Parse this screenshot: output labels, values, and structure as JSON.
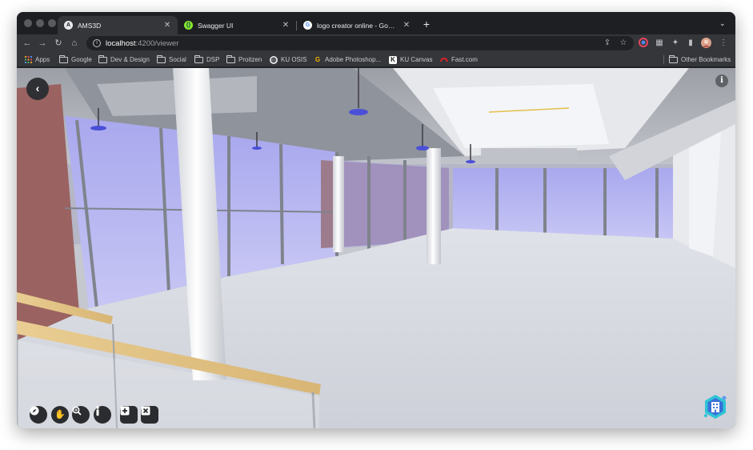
{
  "tabs": [
    {
      "title": "AMS3D",
      "favicon": "A",
      "active": true
    },
    {
      "title": "Swagger UI",
      "favicon": "swagger-icon",
      "active": false
    },
    {
      "title": "logo creator online - Google Se",
      "favicon": "google-icon",
      "active": false
    }
  ],
  "new_tab_label": "+",
  "address": {
    "host": "localhost",
    "path": ":4200/viewer"
  },
  "bookmarks": [
    {
      "label": "Apps",
      "icon": "apps-grid-icon"
    },
    {
      "label": "Google",
      "icon": "folder-icon"
    },
    {
      "label": "Dev & Design",
      "icon": "folder-icon"
    },
    {
      "label": "Social",
      "icon": "folder-icon"
    },
    {
      "label": "DSP",
      "icon": "folder-icon"
    },
    {
      "label": "Proitzen",
      "icon": "folder-icon"
    },
    {
      "label": "KU OSIS",
      "icon": "globe-icon"
    },
    {
      "label": "Adobe Photoshop...",
      "icon": "google-g-icon"
    },
    {
      "label": "KU Canvas",
      "icon": "k-icon"
    },
    {
      "label": "Fast.com",
      "icon": "speedometer-icon"
    }
  ],
  "other_bookmarks": "Other Bookmarks",
  "viewer": {
    "controls": [
      "compass-icon",
      "hand-pan-icon",
      "zoom-icon",
      "person-walk-icon",
      "add-icon",
      "close-box-icon"
    ]
  },
  "colors": {
    "chrome_dark": "#202124",
    "chrome_toolbar": "#35363a",
    "glass": "#b9b8f0",
    "brick": "#9a6260",
    "floor": "#d8dbe2",
    "railing": "#e8c98a",
    "logo_accent": "#2ec4d6"
  }
}
